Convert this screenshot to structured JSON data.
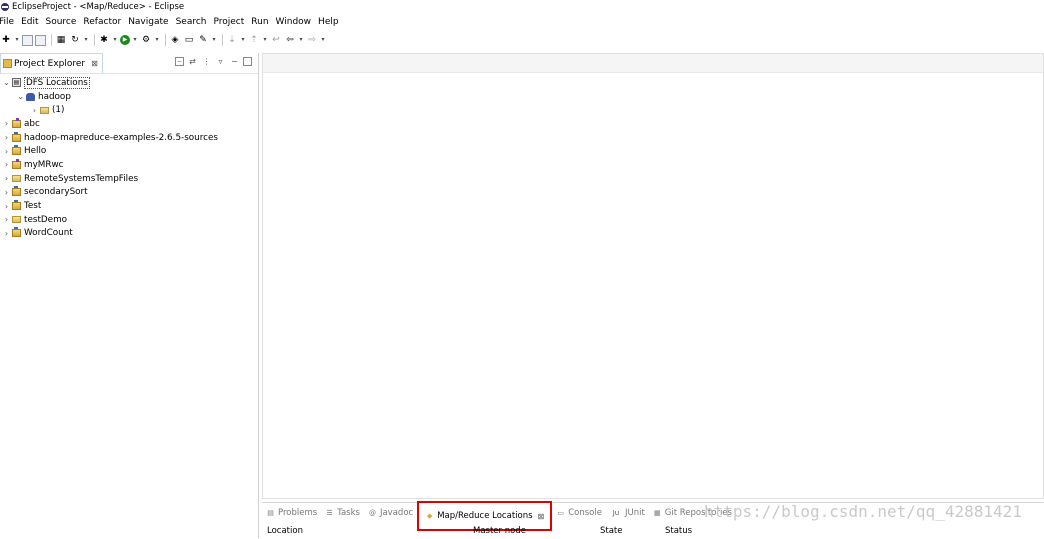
{
  "window": {
    "title": "EclipseProject - <Map/Reduce> - Eclipse"
  },
  "menu": [
    "File",
    "Edit",
    "Source",
    "Refactor",
    "Navigate",
    "Search",
    "Project",
    "Run",
    "Window",
    "Help"
  ],
  "project_explorer": {
    "tab_label": "Project Explorer",
    "close_glyph": "⊠",
    "tree": [
      {
        "label": "DFS Locations",
        "level": 0,
        "twisty": "expanded",
        "icon": "dfs-icon",
        "selected": true
      },
      {
        "label": "hadoop",
        "level": 1,
        "twisty": "expanded",
        "icon": "elephant-icon"
      },
      {
        "label": "(1)",
        "level": 2,
        "twisty": "collapsed",
        "icon": "folder-icon"
      },
      {
        "label": "abc",
        "level": 0,
        "twisty": "collapsed",
        "icon": "mapreduce-project-icon"
      },
      {
        "label": "hadoop-mapreduce-examples-2.6.5-sources",
        "level": 0,
        "twisty": "collapsed",
        "icon": "project-icon"
      },
      {
        "label": "Hello",
        "level": 0,
        "twisty": "collapsed",
        "icon": "project-icon"
      },
      {
        "label": "myMRwc",
        "level": 0,
        "twisty": "collapsed",
        "icon": "mapreduce-project-icon"
      },
      {
        "label": "RemoteSystemsTempFiles",
        "level": 0,
        "twisty": "collapsed",
        "icon": "folder-icon"
      },
      {
        "label": "secondarySort",
        "level": 0,
        "twisty": "collapsed",
        "icon": "project-icon"
      },
      {
        "label": "Test",
        "level": 0,
        "twisty": "collapsed",
        "icon": "project-icon"
      },
      {
        "label": "testDemo",
        "level": 0,
        "twisty": "collapsed",
        "icon": "folder-icon"
      },
      {
        "label": "WordCount",
        "level": 0,
        "twisty": "collapsed",
        "icon": "project-icon"
      }
    ]
  },
  "bottom_tabs": [
    {
      "label": "Problems",
      "icon": "problems-icon",
      "active": false
    },
    {
      "label": "Tasks",
      "icon": "tasks-icon",
      "active": false
    },
    {
      "label": "Javadoc",
      "icon": "javadoc-icon",
      "active": false
    },
    {
      "label": "Map/Reduce Locations",
      "icon": "mapreduce-locations-icon",
      "active": true
    },
    {
      "label": "Console",
      "icon": "console-icon",
      "active": false
    },
    {
      "label": "JUnit",
      "icon": "junit-icon",
      "active": false
    },
    {
      "label": "Git Repositories",
      "icon": "git-repositories-icon",
      "active": false
    }
  ],
  "locations_table": {
    "columns": [
      "Location",
      "Master node",
      "State",
      "Status"
    ]
  },
  "watermark": "https://blog.csdn.net/qq_42881421",
  "colors": {
    "highlight_border": "#e00000",
    "selection_outline": "#555555"
  }
}
